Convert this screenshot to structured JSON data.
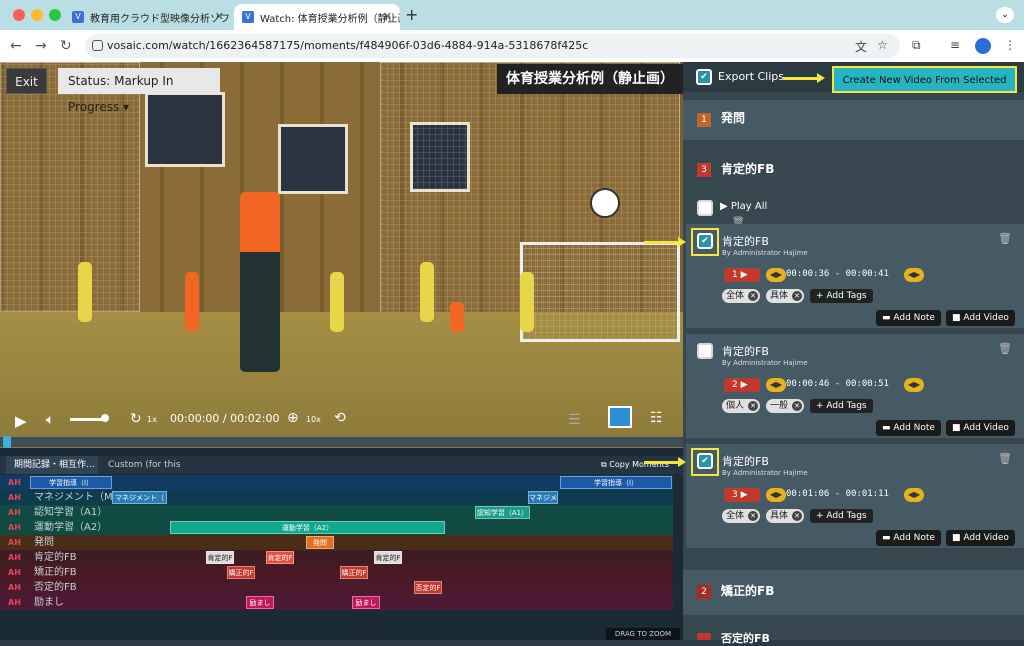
{
  "browser": {
    "tabs": [
      {
        "title": "教育用クラウド型映像分析ソフト"
      },
      {
        "title": "Watch: 体育授業分析例（静止画）"
      }
    ],
    "new_tab": "+",
    "url": "vosaic.com/watch/1662364587175/moments/f484906f-03d6-4884-914a-5318678f425c"
  },
  "header": {
    "exit_label": "Exit",
    "status_label": "Status: Markup In Progress ▾",
    "video_title": "体育授業分析例（静止画）"
  },
  "controls": {
    "speed": "1x",
    "time": "00:00:00 / 00:02:00",
    "zoom": "10x"
  },
  "timeline": {
    "tabs": [
      "期間記録・相互作...",
      "Custom (for this vid..."
    ],
    "copy_label": "Copy Moments",
    "drag_label": "DRAG TO ZOOM",
    "rows": [
      {
        "ah": "AH",
        "label": "",
        "segs": [
          {
            "t": "学習指導（I）"
          },
          {
            "t": "学習指導（I）"
          }
        ]
      },
      {
        "ah": "AH",
        "label": "マネジメント（M",
        "segs": [
          {
            "t": "マネジメント（"
          },
          {
            "t": "マネジメ"
          }
        ]
      },
      {
        "ah": "AH",
        "label": "認知学習（A1）",
        "segs": [
          {
            "t": "認知学習（A1）"
          }
        ]
      },
      {
        "ah": "AH",
        "label": "運動学習（A2）",
        "segs": [
          {
            "t": "運動学習（A2）"
          }
        ]
      },
      {
        "ah": "AH",
        "label": "発問",
        "segs": [
          {
            "t": "発問"
          }
        ]
      },
      {
        "ah": "AH",
        "label": "肯定的FB",
        "segs": [
          {
            "t": "肯定的F"
          },
          {
            "t": "肯定的F"
          },
          {
            "t": "肯定的F"
          }
        ]
      },
      {
        "ah": "AH",
        "label": "矯正的FB",
        "segs": [
          {
            "t": "矯正的F"
          },
          {
            "t": "矯正的F"
          }
        ]
      },
      {
        "ah": "AH",
        "label": "否定的FB",
        "segs": [
          {
            "t": "否定的F"
          }
        ]
      },
      {
        "ah": "AH",
        "label": "励まし",
        "segs": [
          {
            "t": "励まし"
          },
          {
            "t": "励まし"
          }
        ]
      }
    ]
  },
  "panel": {
    "export_label": "Export Clips",
    "create_label": "Create New Video From Selected",
    "sections": [
      {
        "num": "1",
        "name": "発問"
      },
      {
        "num": "3",
        "name": "肯定的FB"
      },
      {
        "num": "2",
        "name": "矯正的FB"
      },
      {
        "num": "",
        "name": "否定的FB"
      }
    ],
    "play_all": "▶ Play All",
    "clips": [
      {
        "name": "肯定的FB",
        "by": "By Administrator Hajime",
        "num": "1",
        "time": "00:00:36 - 00:00:41",
        "tags": [
          "全体",
          "具体"
        ],
        "add_tags": "+ Add Tags",
        "add_note": "Add Note",
        "add_video": "Add Video",
        "checked": true
      },
      {
        "name": "肯定的FB",
        "by": "By Administrator Hajime",
        "num": "2",
        "time": "00:00:46 - 00:00:51",
        "tags": [
          "個人",
          "一般"
        ],
        "add_tags": "+ Add Tags",
        "add_note": "Add Note",
        "add_video": "Add Video",
        "checked": false
      },
      {
        "name": "肯定的FB",
        "by": "By Administrator Hajime",
        "num": "3",
        "time": "00:01:06 - 00:01:11",
        "tags": [
          "全体",
          "具体"
        ],
        "add_tags": "+ Add Tags",
        "add_note": "Add Note",
        "add_video": "Add Video",
        "checked": true
      }
    ]
  }
}
